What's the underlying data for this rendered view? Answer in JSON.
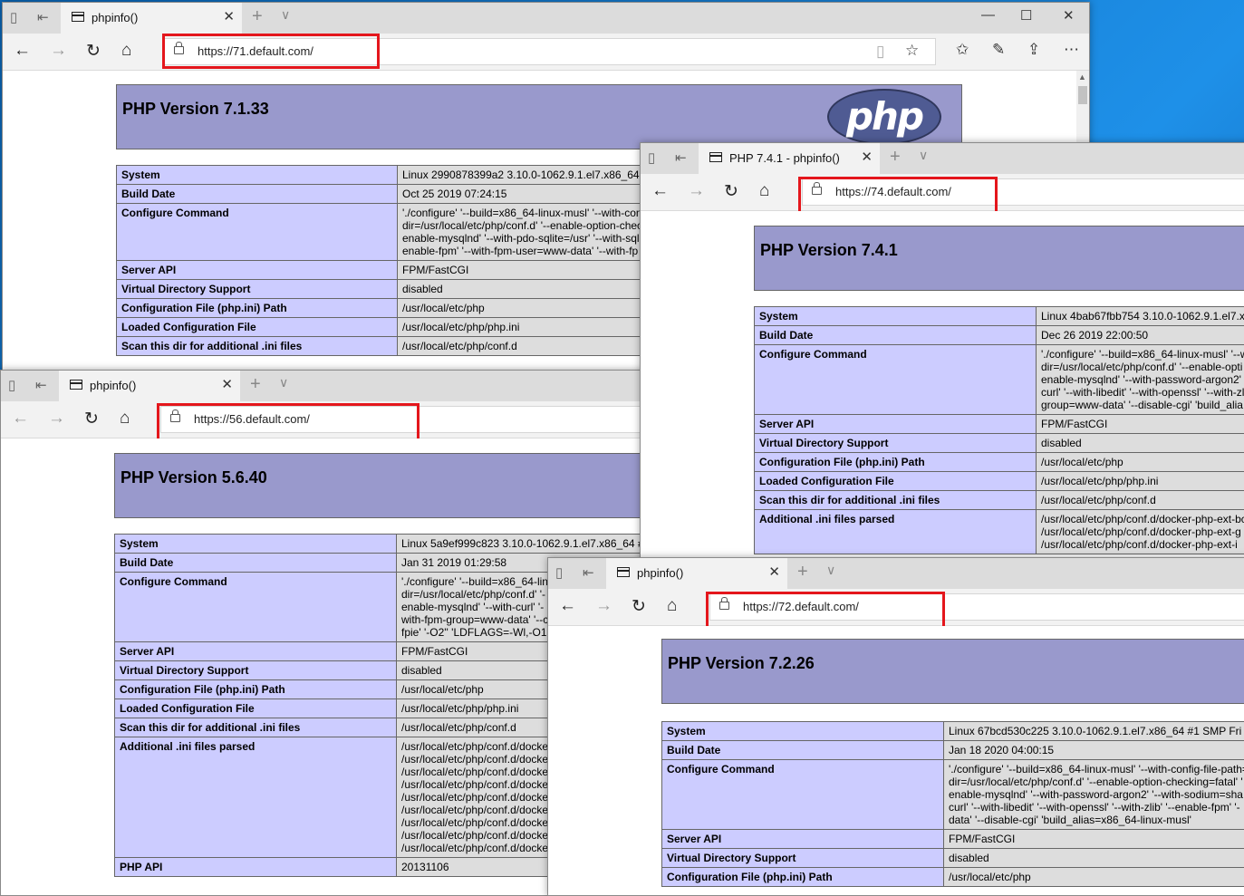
{
  "windows": [
    {
      "id": "w71",
      "tab_title": "phpinfo()",
      "url": "https://71.default.com/",
      "php_version": "PHP Version 7.1.33",
      "logo_text": "php",
      "rows": [
        {
          "label": "System",
          "value": [
            "Linux 2990878399a2 3.10.0-1062.9.1.el7.x86_64"
          ]
        },
        {
          "label": "Build Date",
          "value": [
            "Oct 25 2019 07:24:15"
          ]
        },
        {
          "label": "Configure Command",
          "value": [
            "'./configure' '--build=x86_64-linux-musl' '--with-con",
            "dir=/usr/local/etc/php/conf.d' '--enable-option-chec",
            "enable-mysqlnd' '--with-pdo-sqlite=/usr' '--with-sql",
            "enable-fpm' '--with-fpm-user=www-data' '--with-fp"
          ]
        },
        {
          "label": "Server API",
          "value": [
            "FPM/FastCGI"
          ]
        },
        {
          "label": "Virtual Directory Support",
          "value": [
            "disabled"
          ]
        },
        {
          "label": "Configuration File (php.ini) Path",
          "value": [
            "/usr/local/etc/php"
          ]
        },
        {
          "label": "Loaded Configuration File",
          "value": [
            "/usr/local/etc/php/php.ini"
          ]
        },
        {
          "label": "Scan this dir for additional .ini files",
          "value": [
            "/usr/local/etc/php/conf.d"
          ]
        }
      ]
    },
    {
      "id": "w56",
      "tab_title": "phpinfo()",
      "url": "https://56.default.com/",
      "php_version": "PHP Version 5.6.40",
      "rows": [
        {
          "label": "System",
          "value": [
            "Linux 5a9ef999c823 3.10.0-1062.9.1.el7.x86_64 #"
          ]
        },
        {
          "label": "Build Date",
          "value": [
            "Jan 31 2019 01:29:58"
          ]
        },
        {
          "label": "Configure Command",
          "value": [
            "'./configure' '--build=x86_64-lin",
            "dir=/usr/local/etc/php/conf.d' '-",
            "enable-mysqlnd' '--with-curl' '-",
            "with-fpm-group=www-data' '--c",
            "fpie' '-O2'' 'LDFLAGS=-Wl,-O1"
          ]
        },
        {
          "label": "Server API",
          "value": [
            "FPM/FastCGI"
          ]
        },
        {
          "label": "Virtual Directory Support",
          "value": [
            "disabled"
          ]
        },
        {
          "label": "Configuration File (php.ini) Path",
          "value": [
            "/usr/local/etc/php"
          ]
        },
        {
          "label": "Loaded Configuration File",
          "value": [
            "/usr/local/etc/php/php.ini"
          ]
        },
        {
          "label": "Scan this dir for additional .ini files",
          "value": [
            "/usr/local/etc/php/conf.d"
          ]
        },
        {
          "label": "Additional .ini files parsed",
          "value": [
            "/usr/local/etc/php/conf.d/docke",
            "/usr/local/etc/php/conf.d/docke",
            "/usr/local/etc/php/conf.d/docke",
            "/usr/local/etc/php/conf.d/docke",
            "/usr/local/etc/php/conf.d/docke",
            "/usr/local/etc/php/conf.d/docke",
            "/usr/local/etc/php/conf.d/docke",
            "/usr/local/etc/php/conf.d/docke",
            "/usr/local/etc/php/conf.d/docke"
          ]
        },
        {
          "label": "PHP API",
          "value": [
            "20131106"
          ]
        }
      ]
    },
    {
      "id": "w74",
      "tab_title": "PHP 7.4.1 - phpinfo()",
      "url": "https://74.default.com/",
      "php_version": "PHP Version 7.4.1",
      "rows": [
        {
          "label": "System",
          "value": [
            "Linux 4bab67fbb754 3.10.0-1062.9.1.el7.x"
          ]
        },
        {
          "label": "Build Date",
          "value": [
            "Dec 26 2019 22:00:50"
          ]
        },
        {
          "label": "Configure Command",
          "value": [
            "'./configure' '--build=x86_64-linux-musl' '--w",
            "dir=/usr/local/etc/php/conf.d' '--enable-opti",
            "enable-mysqlnd' '--with-password-argon2' '",
            "curl' '--with-libedit' '--with-openssl' '--with-zl",
            "group=www-data' '--disable-cgi' 'build_alia"
          ]
        },
        {
          "label": "Server API",
          "value": [
            "FPM/FastCGI"
          ]
        },
        {
          "label": "Virtual Directory Support",
          "value": [
            "disabled"
          ]
        },
        {
          "label": "Configuration File (php.ini) Path",
          "value": [
            "/usr/local/etc/php"
          ]
        },
        {
          "label": "Loaded Configuration File",
          "value": [
            "/usr/local/etc/php/php.ini"
          ]
        },
        {
          "label": "Scan this dir for additional .ini files",
          "value": [
            "/usr/local/etc/php/conf.d"
          ]
        },
        {
          "label": "Additional .ini files parsed",
          "value": [
            "/usr/local/etc/php/conf.d/docker-php-ext-bc",
            "/usr/local/etc/php/conf.d/docker-php-ext-g",
            "/usr/local/etc/php/conf.d/docker-php-ext-i"
          ]
        }
      ]
    },
    {
      "id": "w72",
      "tab_title": "phpinfo()",
      "url": "https://72.default.com/",
      "php_version": "PHP Version 7.2.26",
      "rows": [
        {
          "label": "System",
          "value": [
            "Linux 67bcd530c225 3.10.0-1062.9.1.el7.x86_64 #1 SMP Fri"
          ]
        },
        {
          "label": "Build Date",
          "value": [
            "Jan 18 2020 04:00:15"
          ]
        },
        {
          "label": "Configure Command",
          "value": [
            "'./configure' '--build=x86_64-linux-musl' '--with-config-file-path=",
            "dir=/usr/local/etc/php/conf.d' '--enable-option-checking=fatal' '",
            "enable-mysqlnd' '--with-password-argon2' '--with-sodium=sha",
            "curl' '--with-libedit' '--with-openssl' '--with-zlib' '--enable-fpm' '-",
            "data' '--disable-cgi' 'build_alias=x86_64-linux-musl'"
          ]
        },
        {
          "label": "Server API",
          "value": [
            "FPM/FastCGI"
          ]
        },
        {
          "label": "Virtual Directory Support",
          "value": [
            "disabled"
          ]
        },
        {
          "label": "Configuration File (php.ini) Path",
          "value": [
            "/usr/local/etc/php"
          ]
        }
      ]
    }
  ],
  "icons": {
    "back": "←",
    "forward": "→",
    "refresh": "↻",
    "home": "⌂",
    "close": "✕",
    "new_tab": "+",
    "tab_menu": "∨",
    "minimize": "—",
    "maximize": "☐",
    "star": "☆",
    "favorites": "✩",
    "pen": "✎",
    "share": "⇪",
    "more": "⋯",
    "reading": "▯"
  }
}
